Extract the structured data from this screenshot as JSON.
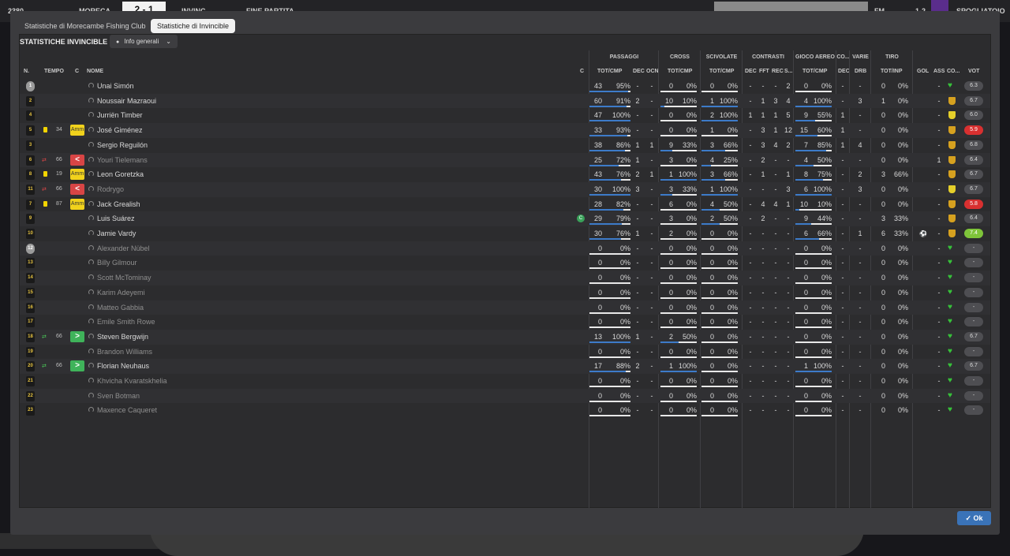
{
  "topbar": {
    "left_num": "2380",
    "team_home": "MORECA",
    "score": "2 - 1",
    "team_away": "INVINC",
    "status": "FINE PARTITA",
    "right_label": "SPOGLIATOIO",
    "fm_label": "FM",
    "extra": "1-2"
  },
  "tabs": [
    {
      "label": "Statistiche di Morecambe Fishing Club"
    },
    {
      "label": "Statistiche di Invincible"
    }
  ],
  "panel": {
    "title": "STATISTICHE INVINCIBLE",
    "dropdown": "Info generali"
  },
  "group_headers": {
    "passaggi": "PASSAGGI",
    "cross": "CROSS",
    "scivolate": "SCIVOLATE",
    "contrasti": "CONTRASTI",
    "gioco_aereo": "GIOCO AEREO",
    "co": "CO...",
    "varie": "VARIE",
    "tiro": "TIRO"
  },
  "col_headers": {
    "n": "N.",
    "tempo": "TEMPO",
    "c": "C",
    "nome": "NOME",
    "c2": "C",
    "pass_totcmp": "TOT/CMP",
    "pass_dec": "DEC",
    "pass_ocn": "OCN",
    "cross_totcmp": "TOT/CMP",
    "sciv_totcmp": "TOT/CMP",
    "con_dec": "DEC",
    "con_fft": "FFT",
    "con_rec": "REC",
    "con_s": "S...",
    "aer_totcmp": "TOT/CMP",
    "co_dec": "DEC",
    "varie_drb": "DRB",
    "tiro_totinp": "TOT/INP",
    "gol": "GOL",
    "ass": "ASS",
    "co2": "CO...",
    "vot": "VOT"
  },
  "players": [
    {
      "num": "1",
      "gk": true,
      "card": "",
      "sub": "",
      "min": "",
      "badge": "",
      "name": "Unai Simón",
      "dim": false,
      "p": [
        "43",
        "95%",
        "-",
        "-"
      ],
      "pf": 0.95,
      "cr": [
        "0",
        "0%"
      ],
      "crf": 0,
      "sc": [
        "0",
        "0%"
      ],
      "scf": 0,
      "ct": [
        "-",
        "-",
        "-",
        "2"
      ],
      "ae": [
        "0",
        "0%"
      ],
      "aef": 0,
      "co": "-",
      "drb": "-",
      "ti": [
        "0",
        "0%"
      ],
      "gol": "",
      "ass": "-",
      "shield": "heart",
      "vot": "6.3",
      "vcls": ""
    },
    {
      "num": "2",
      "gk": false,
      "card": "",
      "sub": "",
      "min": "",
      "badge": "",
      "name": "Noussair Mazraoui",
      "dim": false,
      "p": [
        "60",
        "91%",
        "2",
        "-"
      ],
      "pf": 0.91,
      "cr": [
        "10",
        "10%"
      ],
      "crf": 0.1,
      "sc": [
        "1",
        "100%"
      ],
      "scf": 1,
      "ct": [
        "-",
        "1",
        "3",
        "4"
      ],
      "ae": [
        "4",
        "100%"
      ],
      "aef": 1,
      "co": "-",
      "drb": "3",
      "ti": [
        "1",
        "0%"
      ],
      "gol": "",
      "ass": "-",
      "shield": "shield",
      "vot": "6.7",
      "vcls": ""
    },
    {
      "num": "4",
      "gk": false,
      "card": "",
      "sub": "",
      "min": "",
      "badge": "",
      "name": "Jurriën Timber",
      "dim": false,
      "p": [
        "47",
        "100%",
        "-",
        "-"
      ],
      "pf": 1,
      "cr": [
        "0",
        "0%"
      ],
      "crf": 0,
      "sc": [
        "2",
        "100%"
      ],
      "scf": 1,
      "ct": [
        "1",
        "1",
        "1",
        "5"
      ],
      "ae": [
        "9",
        "55%"
      ],
      "aef": 0.55,
      "co": "1",
      "drb": "-",
      "ti": [
        "0",
        "0%"
      ],
      "gol": "",
      "ass": "-",
      "shield": "shieldy",
      "vot": "6.0",
      "vcls": ""
    },
    {
      "num": "5",
      "gk": false,
      "card": "y",
      "sub": "",
      "min": "34",
      "badge": "amm",
      "name": "José Giménez",
      "dim": false,
      "p": [
        "33",
        "93%",
        "-",
        "-"
      ],
      "pf": 0.93,
      "cr": [
        "0",
        "0%"
      ],
      "crf": 0,
      "sc": [
        "1",
        "0%"
      ],
      "scf": 0,
      "ct": [
        "-",
        "3",
        "1",
        "12"
      ],
      "ae": [
        "15",
        "60%"
      ],
      "aef": 0.6,
      "co": "1",
      "drb": "-",
      "ti": [
        "0",
        "0%"
      ],
      "gol": "",
      "ass": "-",
      "shield": "shield",
      "vot": "5.9",
      "vcls": "red"
    },
    {
      "num": "3",
      "gk": false,
      "card": "",
      "sub": "",
      "min": "",
      "badge": "",
      "name": "Sergio Reguilón",
      "dim": false,
      "p": [
        "38",
        "86%",
        "1",
        "1"
      ],
      "pf": 0.86,
      "cr": [
        "9",
        "33%"
      ],
      "crf": 0.33,
      "sc": [
        "3",
        "66%"
      ],
      "scf": 0.66,
      "ct": [
        "-",
        "3",
        "4",
        "2"
      ],
      "ae": [
        "7",
        "85%"
      ],
      "aef": 0.85,
      "co": "1",
      "drb": "4",
      "ti": [
        "0",
        "0%"
      ],
      "gol": "",
      "ass": "-",
      "shield": "shield",
      "vot": "6.8",
      "vcls": ""
    },
    {
      "num": "6",
      "gk": false,
      "card": "",
      "sub": "out",
      "min": "66",
      "badge": "out",
      "name": "Youri Tielemans",
      "dim": true,
      "p": [
        "25",
        "72%",
        "1",
        "-"
      ],
      "pf": 0.72,
      "cr": [
        "3",
        "0%"
      ],
      "crf": 0,
      "sc": [
        "4",
        "25%"
      ],
      "scf": 0.25,
      "ct": [
        "-",
        "2",
        "-",
        "-"
      ],
      "ae": [
        "4",
        "50%"
      ],
      "aef": 0.5,
      "co": "-",
      "drb": "-",
      "ti": [
        "0",
        "0%"
      ],
      "gol": "",
      "ass": "1",
      "shield": "shield",
      "vot": "6.4",
      "vcls": ""
    },
    {
      "num": "8",
      "gk": false,
      "card": "y",
      "sub": "",
      "min": "19",
      "badge": "amm",
      "name": "Leon Goretzka",
      "dim": false,
      "p": [
        "43",
        "76%",
        "2",
        "1"
      ],
      "pf": 0.76,
      "cr": [
        "1",
        "100%"
      ],
      "crf": 1,
      "sc": [
        "3",
        "66%"
      ],
      "scf": 0.66,
      "ct": [
        "-",
        "1",
        "-",
        "1"
      ],
      "ae": [
        "8",
        "75%"
      ],
      "aef": 0.75,
      "co": "-",
      "drb": "2",
      "ti": [
        "3",
        "66%"
      ],
      "gol": "",
      "ass": "-",
      "shield": "shield",
      "vot": "6.7",
      "vcls": ""
    },
    {
      "num": "11",
      "gk": false,
      "card": "",
      "sub": "out",
      "min": "66",
      "badge": "out",
      "name": "Rodrygo",
      "dim": true,
      "p": [
        "30",
        "100%",
        "3",
        "-"
      ],
      "pf": 1,
      "cr": [
        "3",
        "33%"
      ],
      "crf": 0.33,
      "sc": [
        "1",
        "100%"
      ],
      "scf": 1,
      "ct": [
        "-",
        "-",
        "-",
        "3"
      ],
      "ae": [
        "6",
        "100%"
      ],
      "aef": 1,
      "co": "-",
      "drb": "3",
      "ti": [
        "0",
        "0%"
      ],
      "gol": "",
      "ass": "-",
      "shield": "shieldy",
      "vot": "6.7",
      "vcls": ""
    },
    {
      "num": "7",
      "gk": false,
      "card": "y",
      "sub": "",
      "min": "87",
      "badge": "amm",
      "name": "Jack Grealish",
      "dim": false,
      "p": [
        "28",
        "82%",
        "-",
        "-"
      ],
      "pf": 0.82,
      "cr": [
        "6",
        "0%"
      ],
      "crf": 0,
      "sc": [
        "4",
        "50%"
      ],
      "scf": 0.5,
      "ct": [
        "-",
        "4",
        "4",
        "1"
      ],
      "ae": [
        "10",
        "10%"
      ],
      "aef": 0.1,
      "co": "-",
      "drb": "-",
      "ti": [
        "0",
        "0%"
      ],
      "gol": "",
      "ass": "-",
      "shield": "shield",
      "vot": "5.8",
      "vcls": "red"
    },
    {
      "num": "9",
      "gk": false,
      "card": "",
      "sub": "",
      "min": "",
      "badge": "",
      "name": "Luis Suárez",
      "dim": false,
      "cap": true,
      "p": [
        "29",
        "79%",
        "-",
        "-"
      ],
      "pf": 0.79,
      "cr": [
        "3",
        "0%"
      ],
      "crf": 0,
      "sc": [
        "2",
        "50%"
      ],
      "scf": 0.5,
      "ct": [
        "-",
        "2",
        "-",
        "-"
      ],
      "ae": [
        "9",
        "44%"
      ],
      "aef": 0.44,
      "co": "-",
      "drb": "-",
      "ti": [
        "3",
        "33%"
      ],
      "gol": "",
      "ass": "-",
      "shield": "shield",
      "vot": "6.4",
      "vcls": ""
    },
    {
      "num": "10",
      "gk": false,
      "card": "",
      "sub": "",
      "min": "",
      "badge": "",
      "name": "Jamie Vardy",
      "dim": false,
      "p": [
        "30",
        "76%",
        "1",
        "-"
      ],
      "pf": 0.76,
      "cr": [
        "2",
        "0%"
      ],
      "crf": 0,
      "sc": [
        "0",
        "0%"
      ],
      "scf": 0,
      "ct": [
        "-",
        "-",
        "-",
        "-"
      ],
      "ae": [
        "6",
        "66%"
      ],
      "aef": 0.66,
      "co": "-",
      "drb": "1",
      "ti": [
        "6",
        "33%"
      ],
      "gol": "ball",
      "ass": "-",
      "shield": "shield",
      "vot": "7.4",
      "vcls": "green"
    },
    {
      "num": "12",
      "gk": true,
      "card": "",
      "sub": "",
      "min": "",
      "badge": "",
      "name": "Alexander Nübel",
      "dim": true,
      "p": [
        "0",
        "0%",
        "-",
        "-"
      ],
      "pf": 0,
      "cr": [
        "0",
        "0%"
      ],
      "crf": 0,
      "sc": [
        "0",
        "0%"
      ],
      "scf": 0,
      "ct": [
        "-",
        "-",
        "-",
        "-"
      ],
      "ae": [
        "0",
        "0%"
      ],
      "aef": 0,
      "co": "-",
      "drb": "-",
      "ti": [
        "0",
        "0%"
      ],
      "gol": "",
      "ass": "-",
      "shield": "heart",
      "vot": "-",
      "vcls": ""
    },
    {
      "num": "13",
      "gk": false,
      "card": "",
      "sub": "",
      "min": "",
      "badge": "",
      "name": "Billy Gilmour",
      "dim": true,
      "p": [
        "0",
        "0%",
        "-",
        "-"
      ],
      "pf": 0,
      "cr": [
        "0",
        "0%"
      ],
      "crf": 0,
      "sc": [
        "0",
        "0%"
      ],
      "scf": 0,
      "ct": [
        "-",
        "-",
        "-",
        "-"
      ],
      "ae": [
        "0",
        "0%"
      ],
      "aef": 0,
      "co": "-",
      "drb": "-",
      "ti": [
        "0",
        "0%"
      ],
      "gol": "",
      "ass": "-",
      "shield": "heart",
      "vot": "-",
      "vcls": ""
    },
    {
      "num": "14",
      "gk": false,
      "card": "",
      "sub": "",
      "min": "",
      "badge": "",
      "name": "Scott McTominay",
      "dim": true,
      "p": [
        "0",
        "0%",
        "-",
        "-"
      ],
      "pf": 0,
      "cr": [
        "0",
        "0%"
      ],
      "crf": 0,
      "sc": [
        "0",
        "0%"
      ],
      "scf": 0,
      "ct": [
        "-",
        "-",
        "-",
        "-"
      ],
      "ae": [
        "0",
        "0%"
      ],
      "aef": 0,
      "co": "-",
      "drb": "-",
      "ti": [
        "0",
        "0%"
      ],
      "gol": "",
      "ass": "-",
      "shield": "heart",
      "vot": "-",
      "vcls": ""
    },
    {
      "num": "15",
      "gk": false,
      "card": "",
      "sub": "",
      "min": "",
      "badge": "",
      "name": "Karim Adeyemi",
      "dim": true,
      "p": [
        "0",
        "0%",
        "-",
        "-"
      ],
      "pf": 0,
      "cr": [
        "0",
        "0%"
      ],
      "crf": 0,
      "sc": [
        "0",
        "0%"
      ],
      "scf": 0,
      "ct": [
        "-",
        "-",
        "-",
        "-"
      ],
      "ae": [
        "0",
        "0%"
      ],
      "aef": 0,
      "co": "-",
      "drb": "-",
      "ti": [
        "0",
        "0%"
      ],
      "gol": "",
      "ass": "-",
      "shield": "heart",
      "vot": "-",
      "vcls": ""
    },
    {
      "num": "16",
      "gk": false,
      "card": "",
      "sub": "",
      "min": "",
      "badge": "",
      "name": "Matteo Gabbia",
      "dim": true,
      "p": [
        "0",
        "0%",
        "-",
        "-"
      ],
      "pf": 0,
      "cr": [
        "0",
        "0%"
      ],
      "crf": 0,
      "sc": [
        "0",
        "0%"
      ],
      "scf": 0,
      "ct": [
        "-",
        "-",
        "-",
        "-"
      ],
      "ae": [
        "0",
        "0%"
      ],
      "aef": 0,
      "co": "-",
      "drb": "-",
      "ti": [
        "0",
        "0%"
      ],
      "gol": "",
      "ass": "-",
      "shield": "heart",
      "vot": "-",
      "vcls": ""
    },
    {
      "num": "17",
      "gk": false,
      "card": "",
      "sub": "",
      "min": "",
      "badge": "",
      "name": "Emile Smith Rowe",
      "dim": true,
      "p": [
        "0",
        "0%",
        "-",
        "-"
      ],
      "pf": 0,
      "cr": [
        "0",
        "0%"
      ],
      "crf": 0,
      "sc": [
        "0",
        "0%"
      ],
      "scf": 0,
      "ct": [
        "-",
        "-",
        "-",
        "-"
      ],
      "ae": [
        "0",
        "0%"
      ],
      "aef": 0,
      "co": "-",
      "drb": "-",
      "ti": [
        "0",
        "0%"
      ],
      "gol": "",
      "ass": "-",
      "shield": "heart",
      "vot": "-",
      "vcls": ""
    },
    {
      "num": "18",
      "gk": false,
      "card": "",
      "sub": "in",
      "min": "66",
      "badge": "in",
      "name": "Steven Bergwijn",
      "dim": false,
      "p": [
        "13",
        "100%",
        "1",
        "-"
      ],
      "pf": 1,
      "cr": [
        "2",
        "50%"
      ],
      "crf": 0.5,
      "sc": [
        "0",
        "0%"
      ],
      "scf": 0,
      "ct": [
        "-",
        "-",
        "-",
        "-"
      ],
      "ae": [
        "0",
        "0%"
      ],
      "aef": 0,
      "co": "-",
      "drb": "-",
      "ti": [
        "0",
        "0%"
      ],
      "gol": "",
      "ass": "-",
      "shield": "heart",
      "vot": "6.7",
      "vcls": ""
    },
    {
      "num": "19",
      "gk": false,
      "card": "",
      "sub": "",
      "min": "",
      "badge": "",
      "name": "Brandon Williams",
      "dim": true,
      "p": [
        "0",
        "0%",
        "-",
        "-"
      ],
      "pf": 0,
      "cr": [
        "0",
        "0%"
      ],
      "crf": 0,
      "sc": [
        "0",
        "0%"
      ],
      "scf": 0,
      "ct": [
        "-",
        "-",
        "-",
        "-"
      ],
      "ae": [
        "0",
        "0%"
      ],
      "aef": 0,
      "co": "-",
      "drb": "-",
      "ti": [
        "0",
        "0%"
      ],
      "gol": "",
      "ass": "-",
      "shield": "heart",
      "vot": "-",
      "vcls": ""
    },
    {
      "num": "20",
      "gk": false,
      "card": "",
      "sub": "in",
      "min": "66",
      "badge": "in",
      "name": "Florian Neuhaus",
      "dim": false,
      "p": [
        "17",
        "88%",
        "2",
        "-"
      ],
      "pf": 0.88,
      "cr": [
        "1",
        "100%"
      ],
      "crf": 1,
      "sc": [
        "0",
        "0%"
      ],
      "scf": 0,
      "ct": [
        "-",
        "-",
        "-",
        "-"
      ],
      "ae": [
        "1",
        "100%"
      ],
      "aef": 1,
      "co": "-",
      "drb": "-",
      "ti": [
        "0",
        "0%"
      ],
      "gol": "",
      "ass": "-",
      "shield": "heart",
      "vot": "6.7",
      "vcls": ""
    },
    {
      "num": "21",
      "gk": false,
      "card": "",
      "sub": "",
      "min": "",
      "badge": "",
      "name": "Khvicha Kvaratskhelia",
      "dim": true,
      "p": [
        "0",
        "0%",
        "-",
        "-"
      ],
      "pf": 0,
      "cr": [
        "0",
        "0%"
      ],
      "crf": 0,
      "sc": [
        "0",
        "0%"
      ],
      "scf": 0,
      "ct": [
        "-",
        "-",
        "-",
        "-"
      ],
      "ae": [
        "0",
        "0%"
      ],
      "aef": 0,
      "co": "-",
      "drb": "-",
      "ti": [
        "0",
        "0%"
      ],
      "gol": "",
      "ass": "-",
      "shield": "heart",
      "vot": "-",
      "vcls": ""
    },
    {
      "num": "22",
      "gk": false,
      "card": "",
      "sub": "",
      "min": "",
      "badge": "",
      "name": "Sven Botman",
      "dim": true,
      "p": [
        "0",
        "0%",
        "-",
        "-"
      ],
      "pf": 0,
      "cr": [
        "0",
        "0%"
      ],
      "crf": 0,
      "sc": [
        "0",
        "0%"
      ],
      "scf": 0,
      "ct": [
        "-",
        "-",
        "-",
        "-"
      ],
      "ae": [
        "0",
        "0%"
      ],
      "aef": 0,
      "co": "-",
      "drb": "-",
      "ti": [
        "0",
        "0%"
      ],
      "gol": "",
      "ass": "-",
      "shield": "heart",
      "vot": "-",
      "vcls": ""
    },
    {
      "num": "23",
      "gk": false,
      "card": "",
      "sub": "",
      "min": "",
      "badge": "",
      "name": "Maxence Caqueret",
      "dim": true,
      "p": [
        "0",
        "0%",
        "-",
        "-"
      ],
      "pf": 0,
      "cr": [
        "0",
        "0%"
      ],
      "crf": 0,
      "sc": [
        "0",
        "0%"
      ],
      "scf": 0,
      "ct": [
        "-",
        "-",
        "-",
        "-"
      ],
      "ae": [
        "0",
        "0%"
      ],
      "aef": 0,
      "co": "-",
      "drb": "-",
      "ti": [
        "0",
        "0%"
      ],
      "gol": "",
      "ass": "-",
      "shield": "heart",
      "vot": "-",
      "vcls": ""
    }
  ],
  "badges": {
    "amm": "Amm",
    "out": "<",
    "in": ">",
    "captain": "C"
  },
  "ok_button": "Ok"
}
